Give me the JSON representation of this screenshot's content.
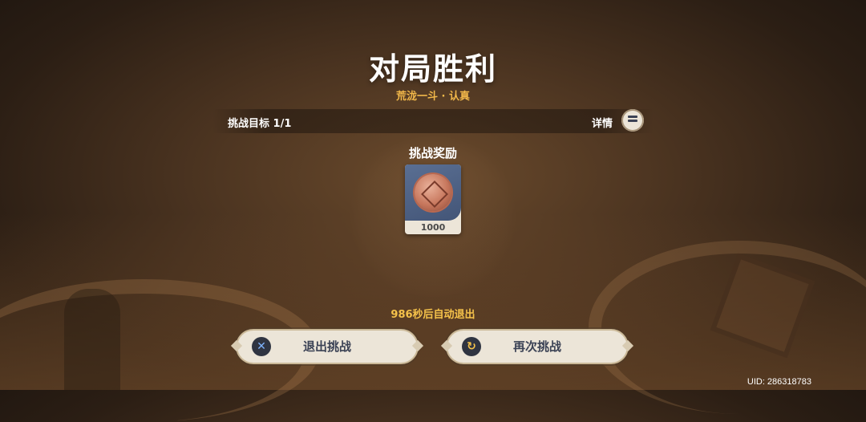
{
  "screen": {
    "title": "对局胜利",
    "subtitle": "荒泷一斗 · 认真"
  },
  "goal_bar": {
    "goal_text": "挑战目标 1/1",
    "details_label": "详情",
    "details_icon": "list-icon"
  },
  "reward": {
    "title": "挑战奖励",
    "item_icon": "coin-icon",
    "item_count": "1000"
  },
  "countdown_text": "986秒后自动退出",
  "buttons": {
    "exit": {
      "label": "退出挑战",
      "icon": "cross-icon"
    },
    "retry": {
      "label": "再次挑战",
      "icon": "retry-icon"
    }
  },
  "uid_text": "UID: 286318783",
  "colors": {
    "accent_gold": "#f5c24a",
    "subtitle_gold": "#f2b84a",
    "button_bg": "#ece5d8",
    "button_text": "#3b4255"
  }
}
